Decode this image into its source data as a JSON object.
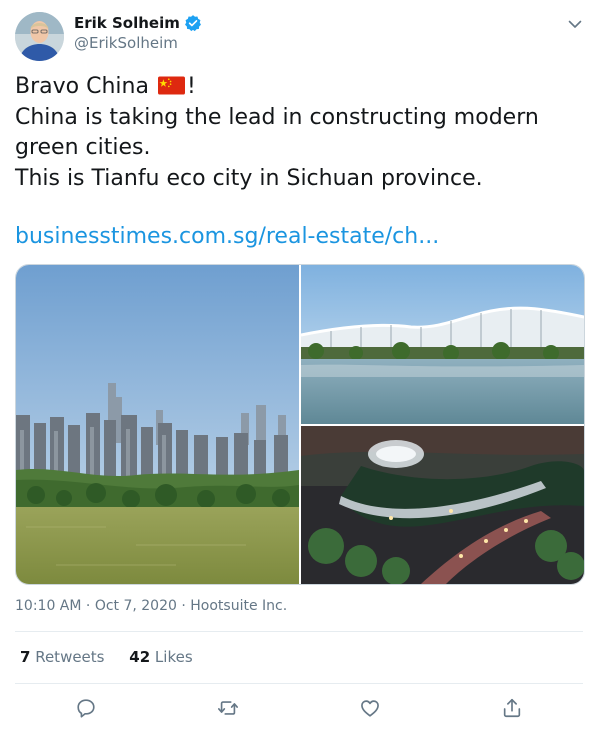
{
  "author": {
    "name": "Erik Solheim",
    "handle": "@ErikSolheim",
    "verified": true
  },
  "tweet": {
    "line1_before_flag": "Bravo China ",
    "line1_after_flag": "!",
    "line2": "China is taking the lead in constructing modern",
    "line3": "green cities.",
    "line4": "This is Tianfu eco city in Sichuan province.",
    "link": "businesstimes.com.sg/real-estate/ch..."
  },
  "meta": {
    "time": "10:10 AM",
    "date": "Oct 7, 2020",
    "source": "Hootsuite Inc.",
    "separator": " · "
  },
  "stats": {
    "retweets_count": "7",
    "retweets_label": " Retweets",
    "likes_count": "42",
    "likes_label": " Likes"
  },
  "icons": {
    "verified": "verified-badge-icon",
    "flag": "china-flag-icon",
    "menu": "chevron-down-icon",
    "reply": "reply-icon",
    "retweet": "retweet-icon",
    "like": "heart-icon",
    "share": "share-icon"
  },
  "colors": {
    "link": "#1b95e0",
    "verified": "#1da1f2",
    "muted": "#657786",
    "text": "#14171a"
  }
}
